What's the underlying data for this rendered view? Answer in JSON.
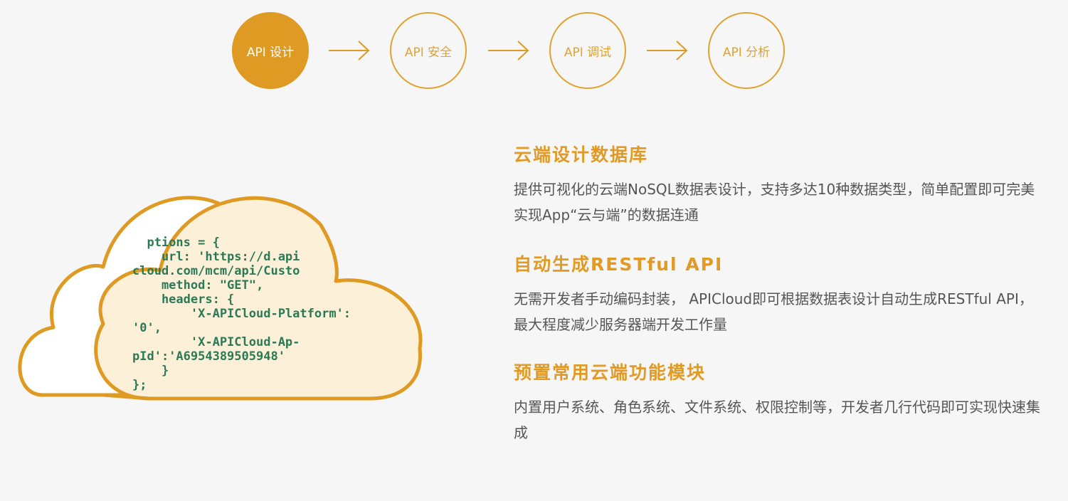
{
  "colors": {
    "accent": "#de9a23",
    "code_text": "#2b7a55",
    "cloud_fill": "#fcf0d9",
    "body_text": "#555555",
    "background": "#f6f6f6"
  },
  "steps": [
    {
      "label": "API 设计",
      "active": true
    },
    {
      "label": "API 安全",
      "active": false
    },
    {
      "label": "API 调试",
      "active": false
    },
    {
      "label": "API 分析",
      "active": false
    }
  ],
  "code_lines": [
    "  ptions = {",
    "    url: 'https://d.api",
    "cloud.com/mcm/api/Custo",
    "    method: \"GET\",",
    "    headers: {",
    "        'X-APICloud-Platform':",
    "'0',",
    "        'X-APICloud-Ap-",
    "pId':'A6954389505948'",
    "    }",
    "};"
  ],
  "features": [
    {
      "title": "云端设计数据库",
      "desc": "提供可视化的云端NoSQL数据表设计，支持多达10种数据类型，简单配置即可完美实现App“云与端”的数据连通"
    },
    {
      "title": "自动生成RESTful API",
      "desc": "无需开发者手动编码封装， APICloud即可根据数据表设计自动生成RESTful API，最大程度减少服务器端开发工作量"
    },
    {
      "title": "预置常用云端功能模块",
      "desc": "内置用户系统、角色系统、文件系统、权限控制等，开发者几行代码即可实现快速集成"
    }
  ]
}
